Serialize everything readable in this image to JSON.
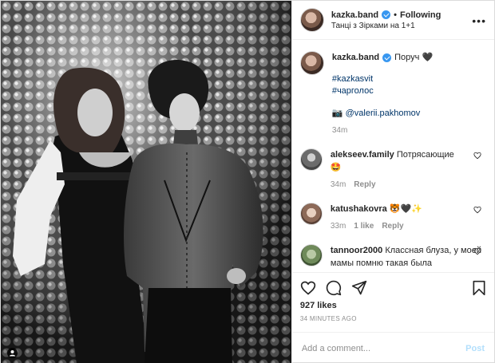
{
  "header": {
    "username": "kazka.band",
    "separator": "•",
    "follow_label": "Following",
    "location": "Танці з Зірками на 1+1",
    "more_icon": "ellipsis-icon"
  },
  "caption": {
    "username": "kazka.band",
    "text": "Поруч 🖤",
    "tags": [
      "#kazkasvit",
      "#чарголос"
    ],
    "credit_icon": "📷",
    "credit": "@valerii.pakhomov",
    "time": "34m"
  },
  "comments": [
    {
      "username": "alekseev.family",
      "text": "Потрясающие",
      "emoji": "🤩",
      "time": "34m",
      "likes": "",
      "reply": "Reply"
    },
    {
      "username": "katushakovra",
      "text": "🐯🖤✨",
      "emoji": "",
      "time": "33m",
      "likes": "1 like",
      "reply": "Reply"
    },
    {
      "username": "tannoor2000",
      "text": "Классная блуза, у моей мамы помню такая была",
      "emoji": "",
      "time": "",
      "likes": "",
      "reply": ""
    }
  ],
  "actions": {
    "likes": "927 likes",
    "timestamp": "34 MINUTES AGO",
    "comment_placeholder": "Add a comment...",
    "post_label": "Post"
  },
  "colors": {
    "link": "#003569",
    "verified": "#3897f0",
    "muted": "#8e8e8e",
    "post_disabled": "#b2dffc"
  }
}
